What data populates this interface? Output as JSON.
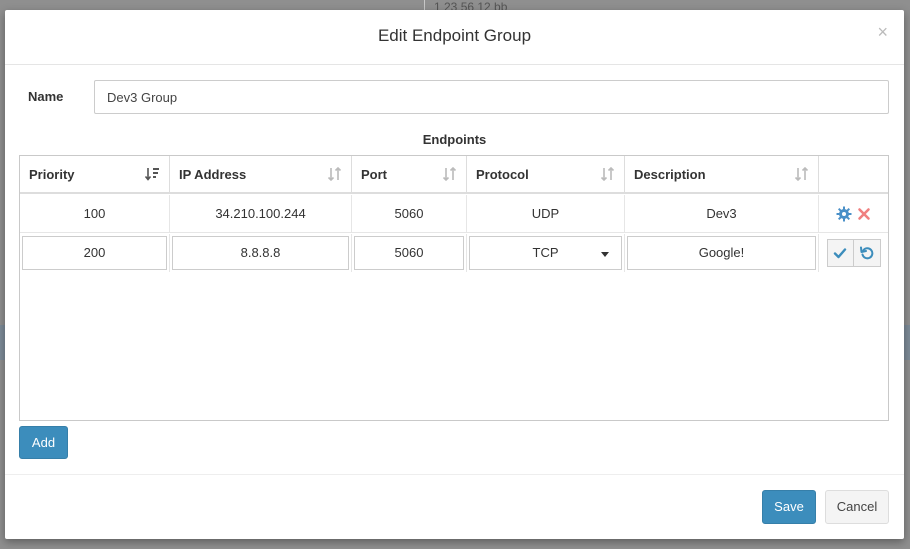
{
  "backdrop": {
    "snippet": "1 23 56 12   bb"
  },
  "modal": {
    "title": "Edit Endpoint Group",
    "close_glyph": "×",
    "name_label": "Name",
    "name_value": "Dev3 Group",
    "section_title": "Endpoints",
    "columns": [
      {
        "label": "Priority",
        "sort_icon": "sort-numeric-desc-icon"
      },
      {
        "label": "IP Address",
        "sort_icon": "sort-icon"
      },
      {
        "label": "Port",
        "sort_icon": "sort-icon"
      },
      {
        "label": "Protocol",
        "sort_icon": "sort-icon"
      },
      {
        "label": "Description",
        "sort_icon": "sort-icon"
      },
      {
        "label": ""
      }
    ],
    "rows": [
      {
        "priority": "100",
        "ip": "34.210.100.244",
        "port": "5060",
        "protocol": "UDP",
        "description": "Dev3",
        "actions": [
          "gear-icon",
          "delete-icon"
        ]
      },
      {
        "priority": "200",
        "ip": "8.8.8.8",
        "port": "5060",
        "protocol": "TCP",
        "description": "Google!",
        "actions": [
          "check-icon",
          "undo-icon"
        ],
        "editing": true
      }
    ],
    "add_label": "Add",
    "save_label": "Save",
    "cancel_label": "Cancel"
  },
  "colors": {
    "primary": "#3c8dbc",
    "gear": "#4a90c8",
    "delete": "#f08080",
    "action_blue": "#3c8dbc"
  }
}
